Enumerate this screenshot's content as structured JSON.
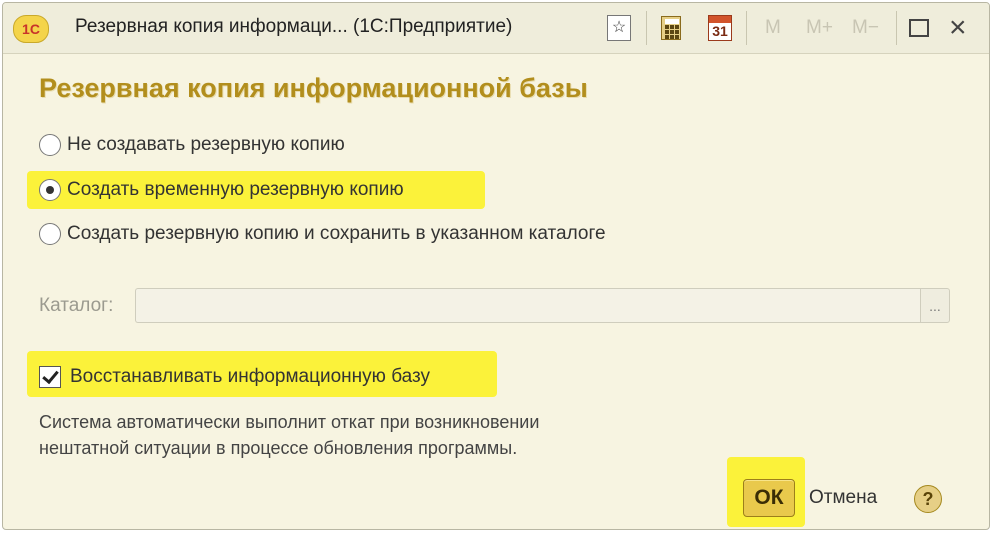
{
  "window": {
    "logo_text": "1С",
    "title": "Резервная копия информаци...  (1С:Предприятие)",
    "toolbar": {
      "favorite_icon": "star-icon",
      "calculator_icon": "calculator-icon",
      "calendar_icon": "calendar-icon",
      "calendar_day": "31",
      "memory_buttons": [
        "M",
        "M+",
        "M−"
      ]
    }
  },
  "form": {
    "heading": "Резервная копия информационной базы",
    "backup_options": [
      {
        "label": "Не создавать резервную копию",
        "selected": false
      },
      {
        "label": "Создать временную резервную копию",
        "selected": true
      },
      {
        "label": "Создать резервную копию и сохранить в указанном каталоге",
        "selected": false
      }
    ],
    "catalog": {
      "label": "Каталог:",
      "value": "",
      "browse_label": "..."
    },
    "restore_checkbox": {
      "label": "Восстанавливать информационную базу",
      "checked": true
    },
    "description_lines": [
      "Система автоматически выполнит откат при возникновении",
      "нештатной ситуации в процессе обновления  программы."
    ]
  },
  "buttons": {
    "ok": "ОК",
    "cancel": "Отмена",
    "help": "?"
  },
  "colors": {
    "window_bg": "#f7f4e1",
    "heading": "#b28e1d",
    "highlight": "#fbf23a",
    "ok_button": "#e9c94c"
  }
}
